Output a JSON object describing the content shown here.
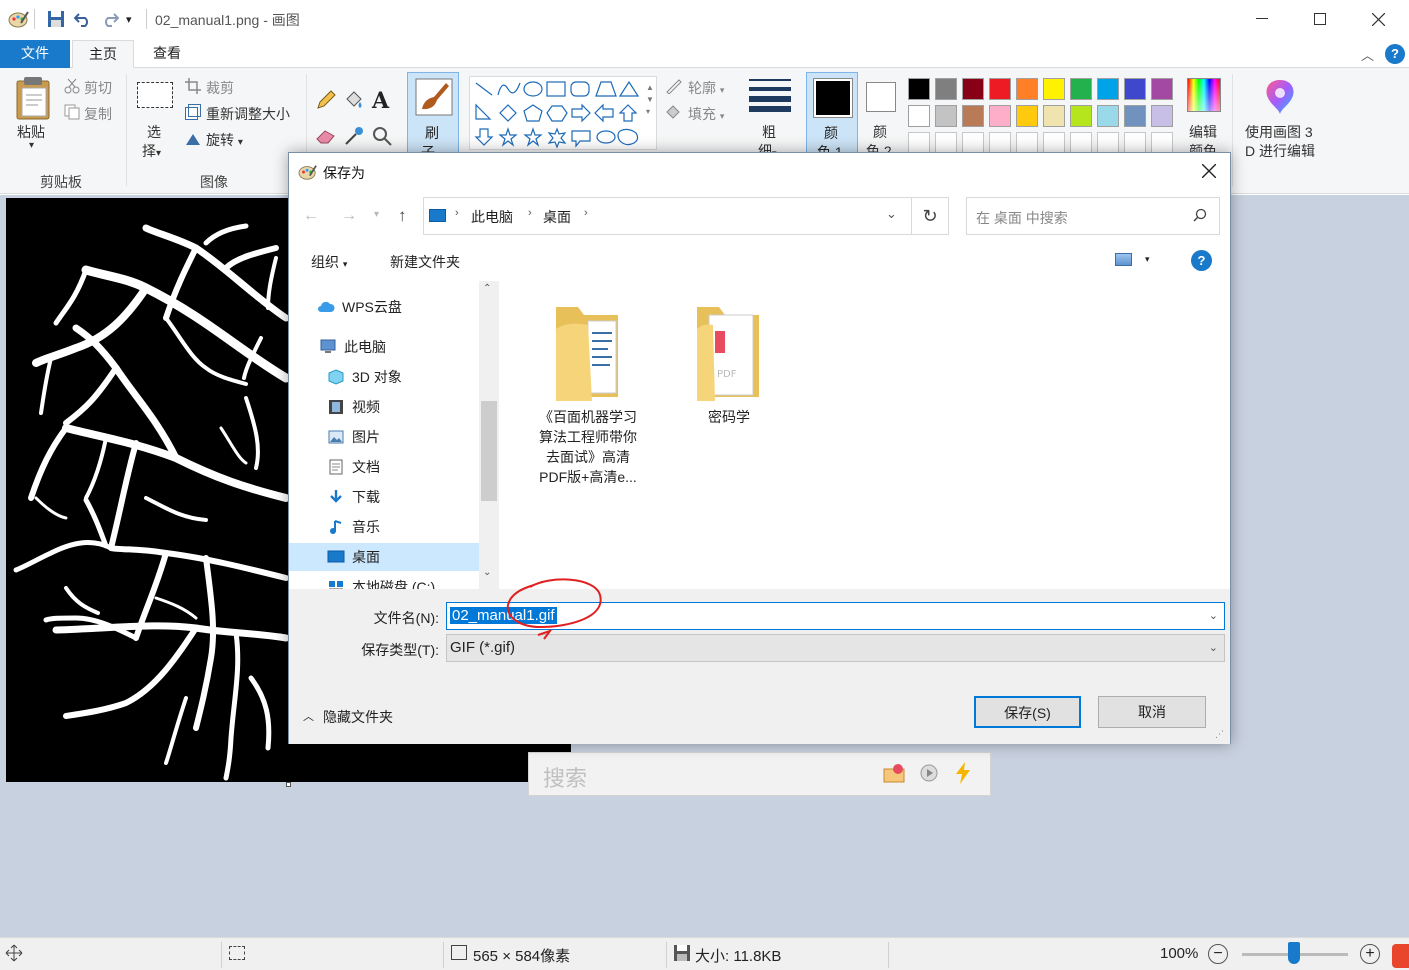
{
  "window": {
    "title": "02_manual1.png - 画图",
    "qat_dropdown": "▾"
  },
  "tabs": {
    "file": "文件",
    "home": "主页",
    "view": "查看"
  },
  "ribbon": {
    "clipboard": {
      "paste": "粘贴",
      "cut": "剪切",
      "copy": "复制",
      "group": "剪贴板"
    },
    "image": {
      "select": "选",
      "select2": "择",
      "crop": "裁剪",
      "resize": "重新调整大小",
      "rotate": "旋转",
      "group": "图像"
    },
    "tools": {
      "brush": "刷",
      "brush2": "子"
    },
    "shapes": {
      "outline": "轮廓",
      "fill": "填充"
    },
    "size": {
      "label": "粗",
      "label2": "细"
    },
    "color1": {
      "label": "颜",
      "label2": "色 1"
    },
    "color2": {
      "label": "颜",
      "label2": "色 2"
    },
    "edit_colors": {
      "label": "编辑",
      "label2": "颜色"
    },
    "paint3d": {
      "label": "使用画图 3",
      "label2": "D 进行编辑"
    },
    "palette_row1": [
      "#000000",
      "#7f7f7f",
      "#880015",
      "#ed1c24",
      "#ff7f27",
      "#fff200",
      "#22b14c",
      "#00a2e8",
      "#3f48cc",
      "#a349a4"
    ],
    "palette_row2": [
      "#ffffff",
      "#c3c3c3",
      "#b97a57",
      "#ffaec9",
      "#ffc90e",
      "#efe4b0",
      "#b5e61d",
      "#99d9ea",
      "#7092be",
      "#c8bfe7"
    ]
  },
  "search_popup": {
    "placeholder": "搜索"
  },
  "statusbar": {
    "dimensions": "565 × 584像素",
    "size": "大小: 11.8KB",
    "zoom": "100%"
  },
  "dialog": {
    "title": "保存为",
    "breadcrumb": [
      "此电脑",
      "桌面"
    ],
    "search_placeholder": "在 桌面 中搜索",
    "organize": "组织",
    "new_folder": "新建文件夹",
    "nav": [
      {
        "label": "WPS云盘",
        "icon": "cloud-icon"
      },
      {
        "label": "此电脑",
        "icon": "computer-icon"
      },
      {
        "label": "3D 对象",
        "icon": "cube-icon"
      },
      {
        "label": "视频",
        "icon": "film-icon"
      },
      {
        "label": "图片",
        "icon": "picture-icon"
      },
      {
        "label": "文档",
        "icon": "document-icon"
      },
      {
        "label": "下载",
        "icon": "download-icon"
      },
      {
        "label": "音乐",
        "icon": "music-icon"
      },
      {
        "label": "桌面",
        "icon": "desktop-icon"
      },
      {
        "label": "本地磁盘 (C:)",
        "icon": "drive-icon"
      }
    ],
    "files": [
      {
        "name_l1": "《百面机器学习",
        "name_l2": "算法工程师带你",
        "name_l3": "去面试》高清",
        "name_l4": "PDF版+高清e..."
      },
      {
        "name_l1": "密码学"
      }
    ],
    "filename_label": "文件名(N):",
    "filename_value": "02_manual1.gif",
    "filetype_label": "保存类型(T):",
    "filetype_value": "GIF (*.gif)",
    "hide_folders": "隐藏文件夹",
    "save": "保存(S)",
    "cancel": "取消"
  }
}
